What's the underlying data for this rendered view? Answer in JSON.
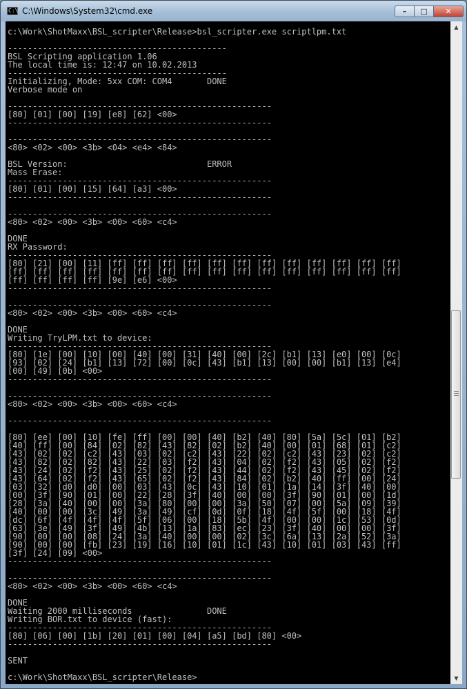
{
  "window": {
    "title": "C:\\Windows\\System32\\cmd.exe",
    "icon": "cmd-icon",
    "icon_label": "C:\\",
    "minimize_glyph": "–",
    "maximize_glyph": "□",
    "close_glyph": "✕"
  },
  "console": {
    "text_color": "#c0c0c0",
    "background": "#000000",
    "lines": [
      "c:\\Work\\ShotMaxx\\BSL_scripter\\Release>bsl_scripter.exe scriptlpm.txt",
      "",
      "--------------------------------------------",
      "BSL Scripting application 1.06",
      "The local time is: 12:47 on 10.02.2013",
      "--------------------------------------------",
      "Initializing, Mode: 5xx COM: COM4       DONE",
      "Verbose mode on",
      "",
      "-----------------------------------------------------",
      "[80] [01] [00] [19] [e8] [62] <00>",
      "-----------------------------------------------------",
      "",
      "-----------------------------------------------------",
      "<80> <02> <00> <3b> <04> <e4> <84>",
      "",
      "BSL Version:                            ERROR",
      "Mass Erase:",
      "-----------------------------------------------------",
      "[80] [01] [00] [15] [64] [a3] <00>",
      "-----------------------------------------------------",
      "",
      "-----------------------------------------------------",
      "<80> <02> <00> <3b> <00> <60> <c4>",
      "",
      "DONE",
      "RX Password:",
      "-----------------------------------------------------",
      "[80] [21] [00] [11] [ff] [ff] [ff] [ff] [ff] [ff] [ff] [ff] [ff] [ff] [ff] [ff]",
      "[ff] [ff] [ff] [ff] [ff] [ff] [ff] [ff] [ff] [ff] [ff] [ff] [ff] [ff] [ff] [ff]",
      "[ff] [ff] [ff] [ff] [9e] [e6] <00>",
      "-----------------------------------------------------",
      "",
      "-----------------------------------------------------",
      "<80> <02> <00> <3b> <00> <60> <c4>",
      "",
      "DONE",
      "Writing TryLPM.txt to device:",
      "-----------------------------------------------------",
      "[80] [1e] [00] [10] [00] [40] [00] [31] [40] [00] [2c] [b1] [13] [e0] [00] [0c]",
      "[93] [02] [24] [b1] [13] [72] [00] [0c] [43] [b1] [13] [00] [00] [b1] [13] [e4]",
      "[00] [49] [0b] <00>",
      "-----------------------------------------------------",
      "",
      "-----------------------------------------------------",
      "<80> <02> <00> <3b> <00> <60> <c4>",
      "",
      "-----------------------------------------------------",
      "",
      "[80] [ee] [00] [10] [fe] [ff] [00] [00] [40] [b2] [40] [80] [5a] [5c] [01] [b2]",
      "[40] [ff] [00] [84] [02] [82] [43] [82] [02] [b2] [40] [00] [01] [68] [01] [c2]",
      "[43] [02] [02] [c2] [43] [03] [02] [c2] [43] [22] [02] [c2] [43] [23] [02] [c2]",
      "[43] [82] [02] [82] [43] [22] [03] [f2] [43] [04] [02] [f2] [43] [05] [02] [f2]",
      "[43] [24] [02] [f2] [43] [25] [02] [f2] [43] [44] [02] [f2] [43] [45] [02] [f2]",
      "[43] [64] [02] [f2] [43] [65] [02] [f2] [43] [84] [02] [b2] [40] [ff] [00] [24]",
      "[03] [32] [d0] [d0] [00] [03] [43] [0c] [43] [10] [01] [1a] [14] [3f] [40] [00]",
      "[00] [3f] [90] [01] [00] [22] [28] [3f] [40] [00] [00] [3f] [90] [01] [00] [1d]",
      "[28] [3a] [40] [00] [00] [3a] [80] [00] [00] [3a] [50] [07] [00] [5a] [09] [39]",
      "[40] [00] [00] [3c] [49] [3a] [49] [cf] [0d] [0f] [18] [4f] [5f] [00] [18] [4f]",
      "[dc] [6f] [4f] [4f] [4f] [5f] [06] [00] [18] [5b] [4f] [00] [00] [1c] [53] [0d]",
      "[63] [3e] [49] [3f] [49] [4b] [13] [1a] [83] [ec] [23] [3f] [40] [00] [00] [3f]",
      "[90] [00] [00] [08] [24] [3a] [40] [00] [00] [02] [3c] [6a] [13] [2a] [52] [3a]",
      "[90] [00] [00] [fb] [23] [19] [16] [10] [01] [1c] [43] [10] [01] [03] [43] [ff]",
      "[3f] [24] [09] <00>",
      "-----------------------------------------------------",
      "",
      "-----------------------------------------------------",
      "<80> <02> <00> <3b> <00> <60> <c4>",
      "",
      "DONE",
      "Waiting 2000 milliseconds               DONE",
      "Writing BOR.txt to device (fast):",
      "-----------------------------------------------------",
      "[80] [06] [00] [1b] [20] [01] [00] [04] [a5] [bd] [80] <00>",
      "-----------------------------------------------------",
      "",
      "SENT",
      "",
      "c:\\Work\\ShotMaxx\\BSL_scripter\\Release>"
    ]
  },
  "scrollbar": {
    "up_glyph": "▲",
    "down_glyph": "▼",
    "position": 0.5
  }
}
